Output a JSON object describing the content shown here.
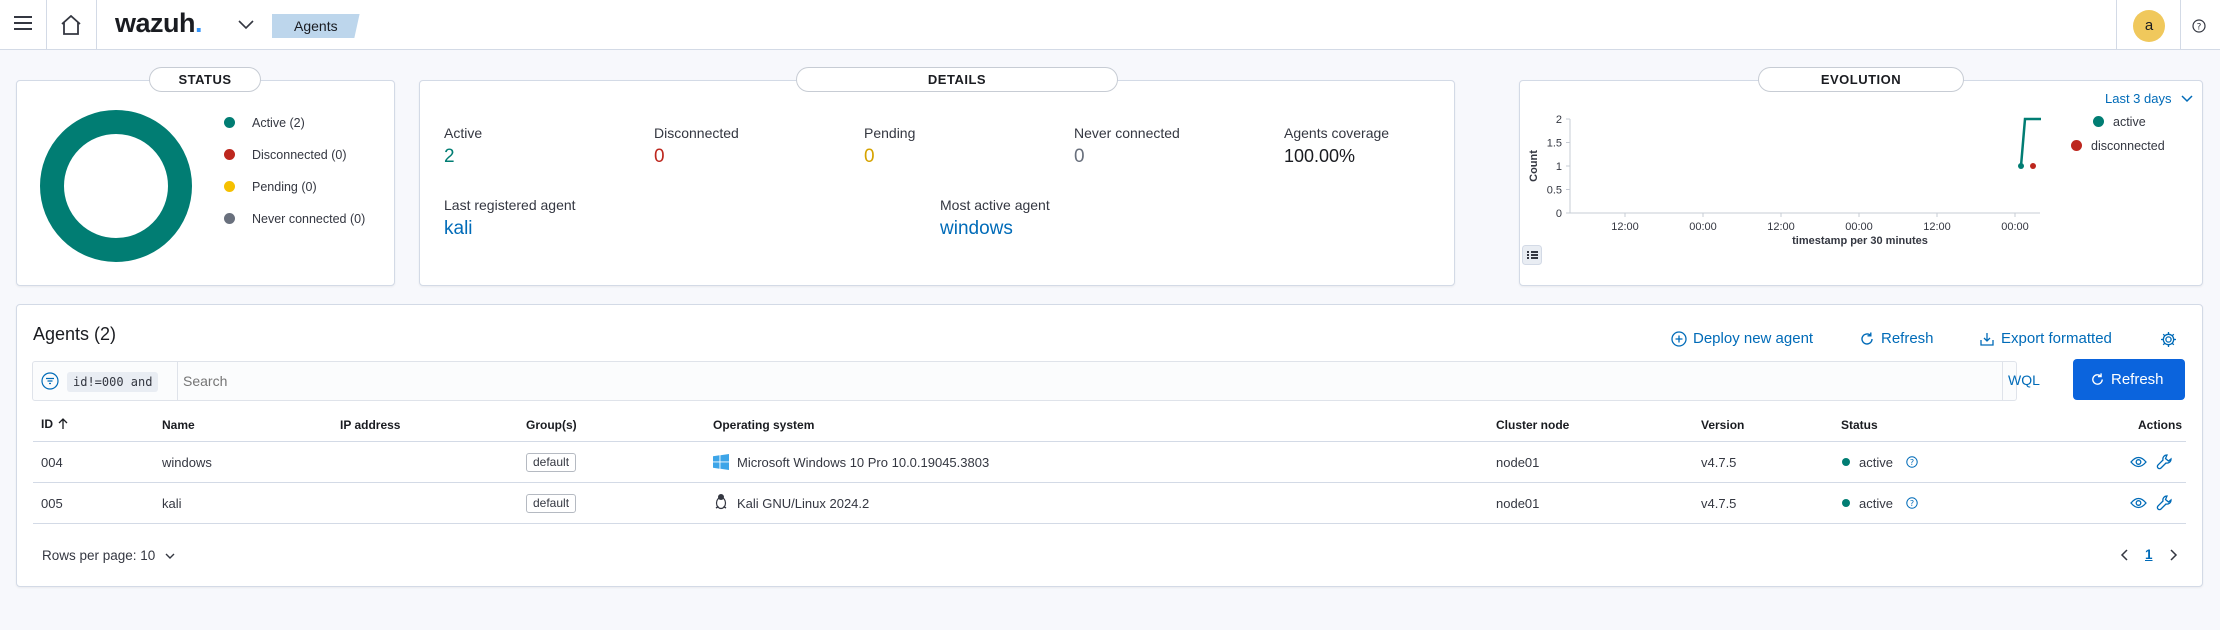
{
  "header": {
    "logo_text": "wazuh",
    "logo_dot": ".",
    "breadcrumb": "Agents",
    "avatar_initial": "a",
    "brand_color": "#3595f9"
  },
  "status": {
    "title": "STATUS",
    "legend": [
      {
        "label": "Active (2)",
        "color": "#017d73"
      },
      {
        "label": "Disconnected (0)",
        "color": "#bd271e"
      },
      {
        "label": "Pending (0)",
        "color": "#f5c000"
      },
      {
        "label": "Never connected (0)",
        "color": "#69707d"
      }
    ]
  },
  "details": {
    "title": "DETAILS",
    "metrics": [
      {
        "label": "Active",
        "value": "2",
        "color": "#017d73"
      },
      {
        "label": "Disconnected",
        "value": "0",
        "color": "#bd271e"
      },
      {
        "label": "Pending",
        "value": "0",
        "color": "#d6a300"
      },
      {
        "label": "Never connected",
        "value": "0",
        "color": "#69707d"
      },
      {
        "label": "Agents coverage",
        "value": "100.00%",
        "color": "#1a1c21"
      }
    ],
    "last_registered_label": "Last registered agent",
    "last_registered_value": "kali",
    "most_active_label": "Most active agent",
    "most_active_value": "windows"
  },
  "evolution": {
    "title": "EVOLUTION",
    "range_label": "Last 3 days",
    "legend": [
      {
        "label": "active",
        "color": "#017d73"
      },
      {
        "label": "disconnected",
        "color": "#bd271e"
      }
    ]
  },
  "chart_data": {
    "type": "line",
    "title": "",
    "xlabel": "timestamp per 30 minutes",
    "ylabel": "Count",
    "x_ticks": [
      "12:00",
      "00:00",
      "12:00",
      "00:00",
      "12:00",
      "00:00"
    ],
    "y_ticks": [
      "0",
      "0.5",
      "1",
      "1.5",
      "2"
    ],
    "ylim": [
      0,
      2
    ],
    "series": [
      {
        "name": "active",
        "color": "#017d73",
        "values": [
          1,
          2,
          2
        ]
      },
      {
        "name": "disconnected",
        "color": "#bd271e",
        "values": [
          1
        ]
      }
    ],
    "legend": "top-right",
    "grid": false
  },
  "agents": {
    "title": "Agents (2)",
    "deploy_label": "Deploy new agent",
    "refresh_link_label": "Refresh",
    "export_label": "Export formatted",
    "search_prefix": "id!=000 and",
    "search_placeholder": "Search",
    "wql_label": "WQL",
    "refresh_button_label": "Refresh",
    "columns": [
      "ID",
      "Name",
      "IP address",
      "Group(s)",
      "Operating system",
      "Cluster node",
      "Version",
      "Status",
      "Actions"
    ],
    "rows": [
      {
        "id": "004",
        "name": "windows",
        "ip": "",
        "group": "default",
        "os": "Microsoft Windows 10 Pro 10.0.19045.3803",
        "os_icon": "windows-icon",
        "node": "node01",
        "version": "v4.7.5",
        "status": "active"
      },
      {
        "id": "005",
        "name": "kali",
        "ip": "",
        "group": "default",
        "os": "Kali GNU/Linux 2024.2",
        "os_icon": "linux-icon",
        "node": "node01",
        "version": "v4.7.5",
        "status": "active"
      }
    ],
    "rows_per_page": "Rows per page: 10",
    "current_page": "1"
  }
}
